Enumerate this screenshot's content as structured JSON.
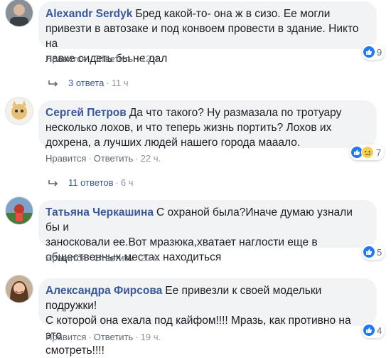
{
  "comments": [
    {
      "author": "Alexandr Serdyk",
      "text_lines": [
        "Бред какой-то- она ж в сизо. Ее могли",
        "привезти в автозаке и под конвоем провести в здание. Никто на",
        "лавке сидеть бы не дал"
      ],
      "like": "Нравится",
      "reply": "Ответить",
      "time": "22 ч.",
      "reaction_count": "9",
      "replies_label": "3 ответа",
      "replies_time": "11 ч"
    },
    {
      "author": "Сергей Петров",
      "text_lines": [
        "Да что такого? Ну размазала по тротуару",
        "несколько лохов, и что теперь жизнь портить? Лохов их",
        "дохрена, а лучших людей нашего города маaало."
      ],
      "like": "Нравится",
      "reply": "Ответить",
      "time": "22 ч.",
      "reaction_count": "7",
      "replies_label": "11 ответов",
      "replies_time": "6 ч"
    },
    {
      "author": "Татьяна Черкашина",
      "text_lines": [
        "С охраной была?Иначе думаю узнали бы и",
        "заносковали ее.Вот мразюка,хватает наглости еще в",
        "общественных местах находиться"
      ],
      "like": "Нравится",
      "reply": "Ответить",
      "time": "20 ч.",
      "reaction_count": "5"
    },
    {
      "author": "Александра Фирсова",
      "text_lines": [
        "Ее привезли к своей модельки подружки!",
        "С которой она ехала под кайфом!!!! Мразь, как противно на это",
        "смотреть!!!!"
      ],
      "like": "Нравится",
      "reply": "Ответить",
      "time": "19 ч.",
      "reaction_count": "4"
    }
  ],
  "colors": {
    "author": "#385898",
    "bubble": "#f2f3f5",
    "like_blue": "#2078f4"
  }
}
